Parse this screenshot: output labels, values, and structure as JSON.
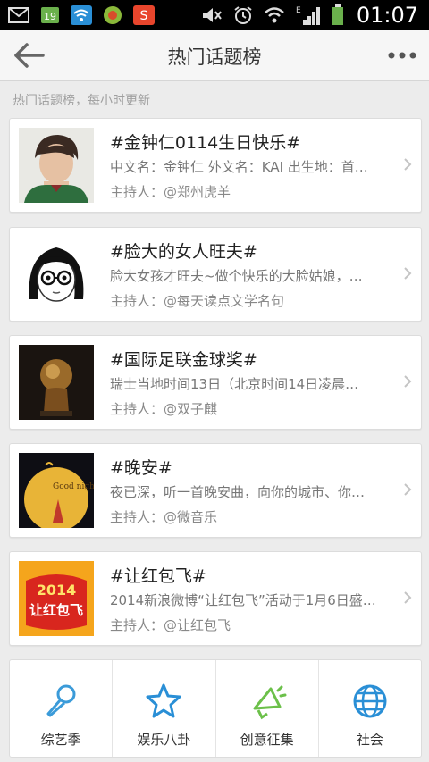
{
  "status_bar": {
    "time": "01:07",
    "network_label": "E",
    "icons": [
      "mail-icon",
      "sim-icon",
      "wifi-icon",
      "app-icon",
      "weibo-notify-icon",
      "mute-icon",
      "alarm-icon",
      "wifi-icon",
      "signal-icon",
      "battery-icon"
    ]
  },
  "header": {
    "title": "热门话题榜",
    "back_icon": "back-arrow-icon",
    "more_icon": "more-dots-icon"
  },
  "subheader": "热门话题榜，每小时更新",
  "topics": [
    {
      "title": "#金钟仁0114生日快乐#",
      "desc": "中文名：金钟仁 外文名：KAI 出生地：首…",
      "host": "主持人：@郑州虎羊",
      "thumb": "portrait-photo"
    },
    {
      "title": "#脸大的女人旺夫#",
      "desc": "脸大女孩才旺夫~做个快乐的大脸姑娘，…",
      "host": "主持人：@每天读点文学名句",
      "thumb": "cartoon-girl"
    },
    {
      "title": "#国际足联金球奖#",
      "desc": "瑞士当地时间13日（北京时间14日凌晨…",
      "host": "主持人：@双子麒",
      "thumb": "golden-ball-trophy"
    },
    {
      "title": "#晚安#",
      "desc": "夜已深，听一首晚安曲，向你的城市、你…",
      "host": "主持人：@微音乐",
      "thumb": "good-night-moon"
    },
    {
      "title": "#让红包飞#",
      "desc": "2014新浪微博“让红包飞”活动于1月6日盛…",
      "host": "主持人：@让红包飞",
      "thumb": "red-envelope-2014",
      "thumb_text_top": "2014",
      "thumb_text_bottom": "让红包飞"
    }
  ],
  "thumb_text": {
    "good_night": "Good night"
  },
  "categories": [
    {
      "label": "综艺季",
      "icon": "microphone-icon",
      "color": "#3b9bd9"
    },
    {
      "label": "娱乐八卦",
      "icon": "star-icon",
      "color": "#2a8fd6"
    },
    {
      "label": "创意征集",
      "icon": "megaphone-icon",
      "color": "#6cc04a"
    },
    {
      "label": "社会",
      "icon": "globe-icon",
      "color": "#2a8fd6"
    }
  ]
}
